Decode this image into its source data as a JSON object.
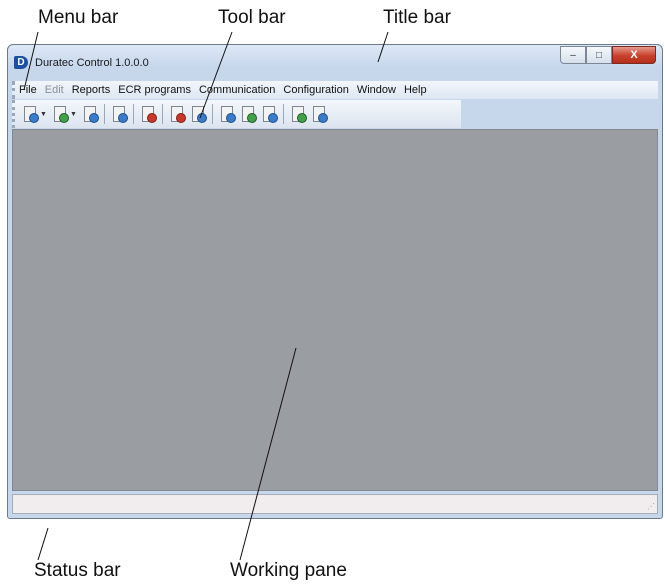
{
  "callouts": {
    "menu_bar": "Menu bar",
    "tool_bar": "Tool bar",
    "title_bar": "Title bar",
    "status_bar": "Status bar",
    "working_pane": "Working pane"
  },
  "window": {
    "app_icon_letter": "D",
    "title": "Duratec Control 1.0.0.0",
    "caption_buttons": {
      "minimize": "–",
      "maximize": "□",
      "close": "X"
    }
  },
  "menu": {
    "items": [
      {
        "label": "File",
        "enabled": true
      },
      {
        "label": "Edit",
        "enabled": false
      },
      {
        "label": "Reports",
        "enabled": true
      },
      {
        "label": "ECR programs",
        "enabled": true
      },
      {
        "label": "Communication",
        "enabled": true
      },
      {
        "label": "Configuration",
        "enabled": true
      },
      {
        "label": "Window",
        "enabled": true
      },
      {
        "label": "Help",
        "enabled": true
      }
    ]
  },
  "toolbar": {
    "icons": [
      "view-document-icon",
      "new-document-icon",
      "database-view-icon",
      "ecr-transfer-icon",
      "ecr-edit-icon",
      "ecr-stop-icon",
      "ecr-send-icon",
      "report-view-icon",
      "network-config-icon",
      "config-settings-icon",
      "printer-icon",
      "printer-wireless-icon"
    ]
  },
  "colors": {
    "working_pane": "#9a9ea3",
    "close_button": "#c7412c",
    "title_bar": "#c6d7ec"
  }
}
